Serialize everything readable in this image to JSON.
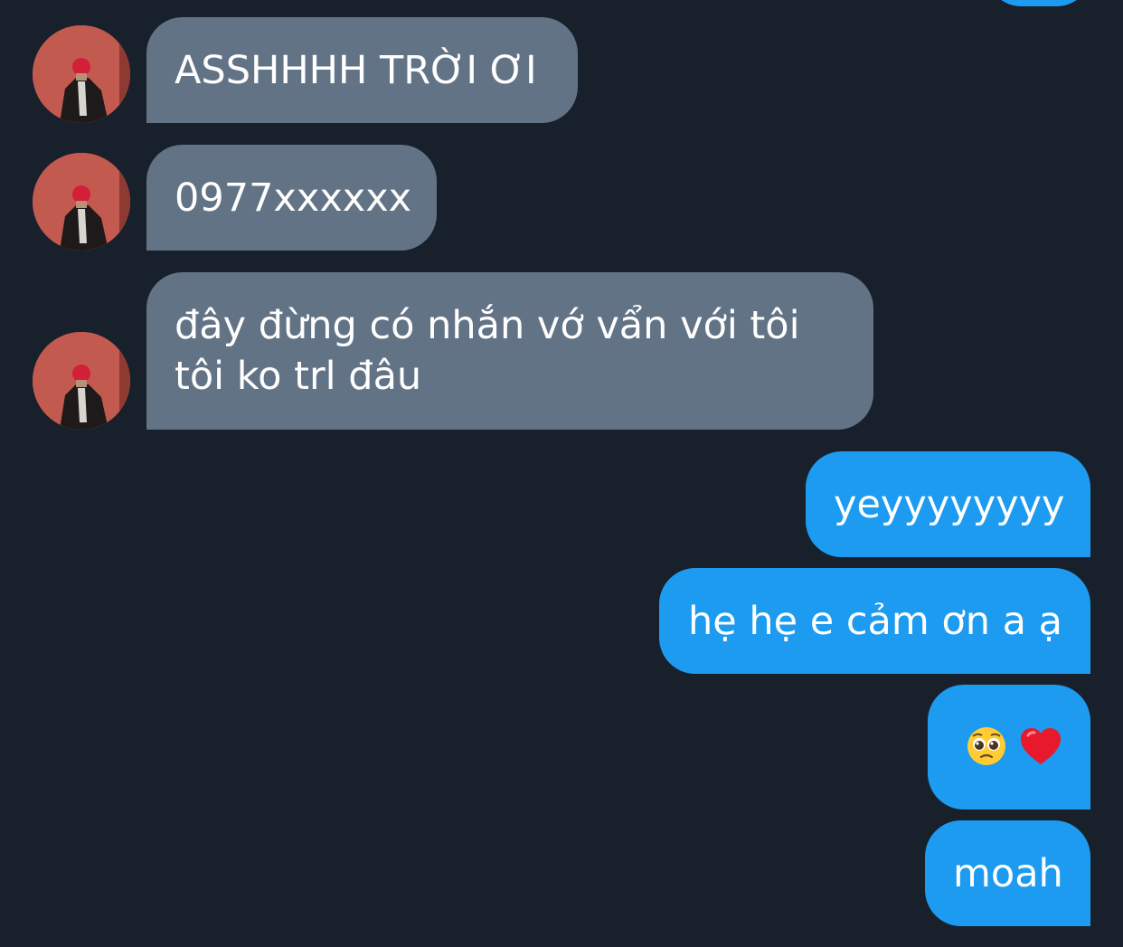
{
  "conversation": {
    "messages": [
      {
        "direction": "incoming",
        "text": "ASSHHHH TRỜI ƠI"
      },
      {
        "direction": "incoming",
        "text": "0977xxxxxx"
      },
      {
        "direction": "incoming",
        "lines": [
          "đây đừng có nhắn vớ vẩn với tôi",
          "tôi ko trl đâu"
        ]
      },
      {
        "direction": "outgoing",
        "text": "yeyyyyyyyy"
      },
      {
        "direction": "outgoing",
        "text": "hẹ hẹ e cảm ơn a ạ"
      },
      {
        "direction": "outgoing",
        "emoji": [
          "pleading-face",
          "red-heart"
        ]
      },
      {
        "direction": "outgoing",
        "text": "moah"
      }
    ]
  },
  "colors": {
    "background": "#18202b",
    "incoming_bubble": "#637386",
    "outgoing_bubble": "#1d9bf0",
    "text": "#ffffff"
  },
  "icons": {
    "avatar": "avatar-photo",
    "emoji_1": "pleading-face-icon",
    "emoji_2": "red-heart-icon"
  }
}
